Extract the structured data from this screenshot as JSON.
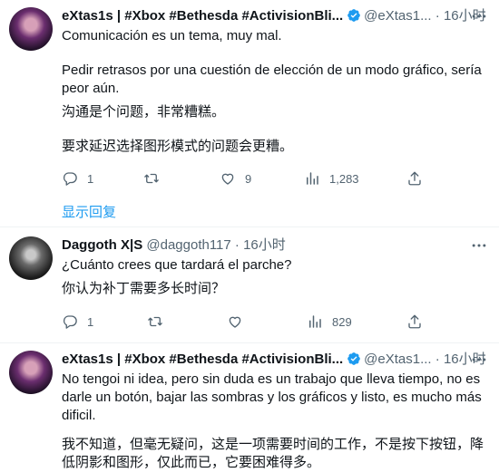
{
  "tweets": [
    {
      "name": "eXtas1s | #Xbox #Bethesda #ActivisionBli...",
      "handle": "@eXtas1...",
      "sep": "·",
      "time": "16小时",
      "lines": [
        "Comunicación es un tema, muy mal.",
        "Pedir retrasos por una cuestión de elección de un modo gráfico, sería peor aún.",
        "沟通是个问题，非常糟糕。",
        "要求延迟选择图形模式的问题会更糟。"
      ],
      "stats": {
        "replies": "1",
        "retweets": "",
        "likes": "9",
        "views": "1,283"
      },
      "show_replies": "显示回复"
    },
    {
      "name": "Daggoth X|S",
      "handle": "@daggoth117",
      "sep": "·",
      "time": "16小时",
      "lines": [
        "¿Cuánto crees que tardará el parche?",
        "你认为补丁需要多长时间？"
      ],
      "stats": {
        "replies": "1",
        "retweets": "",
        "likes": "",
        "views": "829"
      }
    },
    {
      "name": "eXtas1s | #Xbox #Bethesda #ActivisionBli...",
      "handle": "@eXtas1...",
      "sep": "·",
      "time": "16小时",
      "lines": [
        "No tengoi ni idea, pero sin duda es un trabajo que lleva tiempo, no es darle un botón, bajar las sombras y los gráficos y listo, es mucho más dificil.",
        "我不知道，但毫无疑问，这是一项需要时间的工作，不是按下按钮，降低阴影和图形，仅此而已，它要困难得多。"
      ]
    }
  ],
  "colors": {
    "verified": "#1d9bf0",
    "link": "#1d9bf0",
    "muted": "#536471",
    "text": "#0f1419"
  },
  "icons": [
    "reply-icon",
    "retweet-icon",
    "like-icon",
    "views-icon",
    "share-icon",
    "verified-badge-icon",
    "more-icon"
  ]
}
